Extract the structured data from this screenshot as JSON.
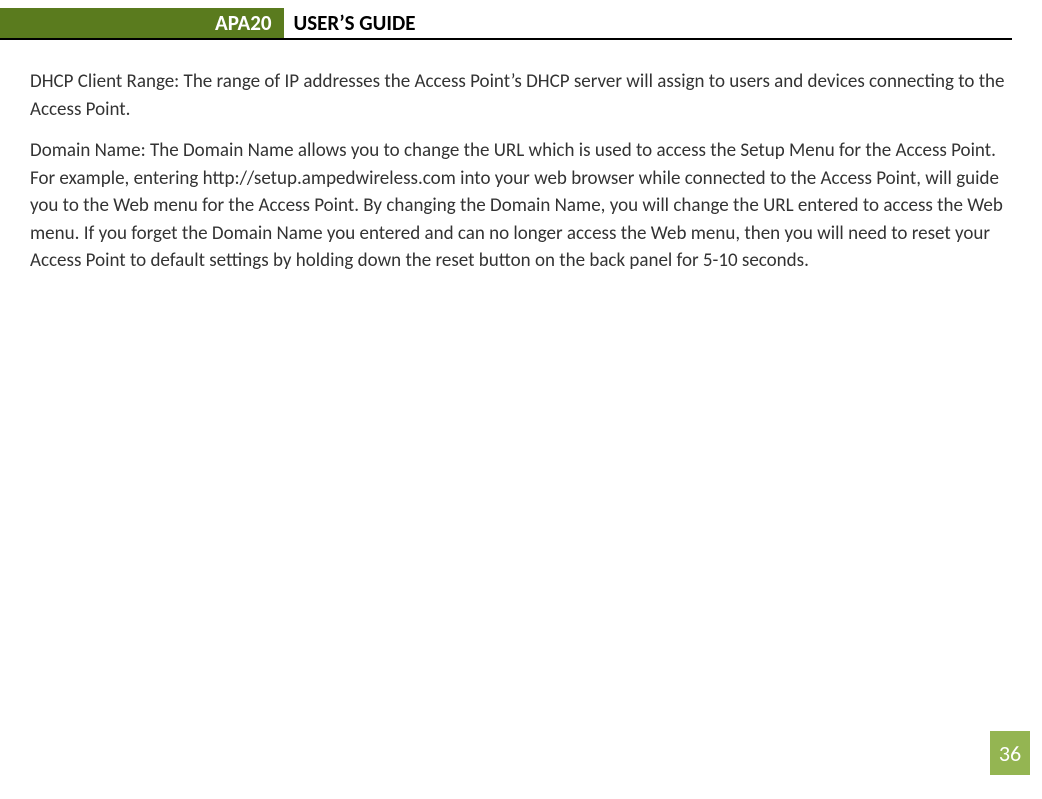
{
  "header": {
    "badge": "APA20",
    "title": "USER’S GUIDE"
  },
  "content": {
    "para1": "DHCP Client Range: The range of IP addresses the Access Point’s DHCP server will assign to users and devices connecting to the Access Point.",
    "para2": "Domain Name: The Domain Name allows you to change the URL which is used to access the Setup Menu for the Access Point. For example, entering http://setup.ampedwireless.com into your web browser while connected to the Access Point, will guide you to the Web menu for the Access Point. By changing the Domain Name, you will change the URL entered to access the Web menu. If you forget the Domain Name you entered and can no longer access the Web menu, then you will need to reset your Access Point to default settings by holding down the reset button on the back panel for 5-10 seconds."
  },
  "page_number": "36",
  "colors": {
    "brand_green_dark": "#5a7b1e",
    "brand_green_light": "#94b552"
  }
}
